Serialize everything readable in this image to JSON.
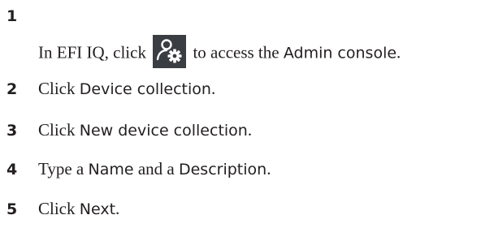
{
  "steps": [
    {
      "number": "1",
      "before_icon": "In EFI IQ, click",
      "icon": "admin-console-icon",
      "after_icon": "to access the",
      "ui_term": "Admin console",
      "end": "."
    },
    {
      "number": "2",
      "prefix": "Click",
      "ui_term": "Device collection",
      "end": "."
    },
    {
      "number": "3",
      "prefix": "Click",
      "ui_term": "New device collection",
      "end": "."
    },
    {
      "number": "4",
      "prefix": "Type a",
      "ui_term": "Name",
      "middle": "and a",
      "ui_term_2": "Description",
      "end": "."
    },
    {
      "number": "5",
      "prefix": "Click",
      "ui_term": "Next",
      "end": "."
    }
  ],
  "colors": {
    "icon_background": "#3a3d42",
    "icon_foreground": "#ffffff",
    "text": "#231f20"
  }
}
